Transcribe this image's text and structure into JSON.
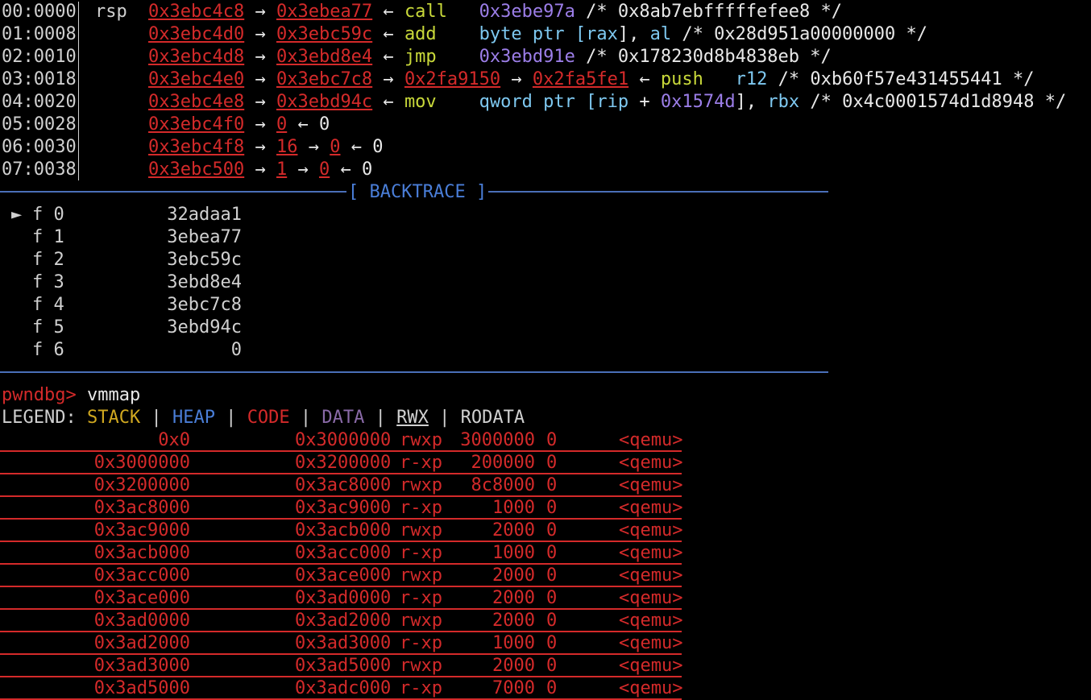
{
  "stack": [
    {
      "idx": "00:0000",
      "reg": "rsp",
      "chain": [
        {
          "t": "0x3ebc4c8",
          "c": "redu"
        },
        {
          "t": " → ",
          "c": "white"
        },
        {
          "t": "0x3ebea77",
          "c": "redu"
        },
        {
          "t": " ← ",
          "c": "white"
        },
        {
          "t": "call",
          "c": "yg"
        },
        {
          "t": "   ",
          "c": "white"
        },
        {
          "t": "0x3ebe97a",
          "c": "purple"
        },
        {
          "t": " /* 0x8ab7ebfffffefee8 */",
          "c": "white"
        }
      ]
    },
    {
      "idx": "01:0008",
      "reg": "",
      "chain": [
        {
          "t": "0x3ebc4d0",
          "c": "redu"
        },
        {
          "t": " → ",
          "c": "white"
        },
        {
          "t": "0x3ebc59c",
          "c": "redu"
        },
        {
          "t": " ← ",
          "c": "white"
        },
        {
          "t": "add",
          "c": "yg"
        },
        {
          "t": "    ",
          "c": "white"
        },
        {
          "t": "byte ptr [",
          "c": "cyan"
        },
        {
          "t": "rax",
          "c": "cyan"
        },
        {
          "t": "], ",
          "c": "white"
        },
        {
          "t": "al",
          "c": "cyan"
        },
        {
          "t": " /* 0x28d951a00000000 */",
          "c": "white"
        }
      ]
    },
    {
      "idx": "02:0010",
      "reg": "",
      "chain": [
        {
          "t": "0x3ebc4d8",
          "c": "redu"
        },
        {
          "t": " → ",
          "c": "white"
        },
        {
          "t": "0x3ebd8e4",
          "c": "redu"
        },
        {
          "t": " ← ",
          "c": "white"
        },
        {
          "t": "jmp",
          "c": "yg"
        },
        {
          "t": "    ",
          "c": "white"
        },
        {
          "t": "0x3ebd91e",
          "c": "purple"
        },
        {
          "t": " /* 0x178230d8b4838eb */",
          "c": "white"
        }
      ]
    },
    {
      "idx": "03:0018",
      "reg": "",
      "chain": [
        {
          "t": "0x3ebc4e0",
          "c": "redu"
        },
        {
          "t": " → ",
          "c": "white"
        },
        {
          "t": "0x3ebc7c8",
          "c": "redu"
        },
        {
          "t": " → ",
          "c": "white"
        },
        {
          "t": "0x2fa9150",
          "c": "redu"
        },
        {
          "t": " → ",
          "c": "white"
        },
        {
          "t": "0x2fa5fe1",
          "c": "redu"
        },
        {
          "t": " ← ",
          "c": "white"
        },
        {
          "t": "push",
          "c": "yg"
        },
        {
          "t": "   ",
          "c": "white"
        },
        {
          "t": "r12",
          "c": "cyan"
        },
        {
          "t": " /* 0xb60f57e431455441 */",
          "c": "white"
        }
      ]
    },
    {
      "idx": "04:0020",
      "reg": "",
      "chain": [
        {
          "t": "0x3ebc4e8",
          "c": "redu"
        },
        {
          "t": " → ",
          "c": "white"
        },
        {
          "t": "0x3ebd94c",
          "c": "redu"
        },
        {
          "t": " ← ",
          "c": "white"
        },
        {
          "t": "mov",
          "c": "yg"
        },
        {
          "t": "    ",
          "c": "white"
        },
        {
          "t": "qword ptr [",
          "c": "cyan"
        },
        {
          "t": "rip",
          "c": "cyan"
        },
        {
          "t": " + ",
          "c": "white"
        },
        {
          "t": "0x1574d",
          "c": "purple"
        },
        {
          "t": "], ",
          "c": "white"
        },
        {
          "t": "rbx",
          "c": "cyan"
        },
        {
          "t": " /* 0x4c0001574d1d8948 */",
          "c": "white"
        }
      ]
    },
    {
      "idx": "05:0028",
      "reg": "",
      "chain": [
        {
          "t": "0x3ebc4f0",
          "c": "redu"
        },
        {
          "t": " → ",
          "c": "white"
        },
        {
          "t": "0",
          "c": "redu"
        },
        {
          "t": " ← 0",
          "c": "white"
        }
      ]
    },
    {
      "idx": "06:0030",
      "reg": "",
      "chain": [
        {
          "t": "0x3ebc4f8",
          "c": "redu"
        },
        {
          "t": " → ",
          "c": "white"
        },
        {
          "t": "16",
          "c": "redu"
        },
        {
          "t": " → ",
          "c": "white"
        },
        {
          "t": "0",
          "c": "redu"
        },
        {
          "t": " ← 0",
          "c": "white"
        }
      ]
    },
    {
      "idx": "07:0038",
      "reg": "",
      "chain": [
        {
          "t": "0x3ebc500",
          "c": "redu"
        },
        {
          "t": " → ",
          "c": "white"
        },
        {
          "t": "1",
          "c": "redu"
        },
        {
          "t": " → ",
          "c": "white"
        },
        {
          "t": "0",
          "c": "redu"
        },
        {
          "t": " ← 0",
          "c": "white"
        }
      ]
    }
  ],
  "backtrace": {
    "title": "[ BACKTRACE ]",
    "current_marker": "►",
    "frames": [
      {
        "label": "f 0",
        "addr": "32adaa1"
      },
      {
        "label": "f 1",
        "addr": "3ebea77"
      },
      {
        "label": "f 2",
        "addr": "3ebc59c"
      },
      {
        "label": "f 3",
        "addr": "3ebd8e4"
      },
      {
        "label": "f 4",
        "addr": "3ebc7c8"
      },
      {
        "label": "f 5",
        "addr": "3ebd94c"
      },
      {
        "label": "f 6",
        "addr": "0"
      }
    ]
  },
  "prompt": {
    "text": "pwndbg>",
    "command": " vmmap"
  },
  "legend": {
    "label": "LEGEND:",
    "stack": "STACK",
    "heap": "HEAP",
    "code": "CODE",
    "data": "DATA",
    "rwx": "RWX",
    "rodata": "RODATA",
    "sep": " | "
  },
  "vmmap": [
    {
      "start": "0x0",
      "end": "0x3000000",
      "perm": "rwxp",
      "size": "3000000",
      "offset": "0",
      "name": "<qemu>"
    },
    {
      "start": "0x3000000",
      "end": "0x3200000",
      "perm": "r-xp",
      "size": "200000",
      "offset": "0",
      "name": "<qemu>"
    },
    {
      "start": "0x3200000",
      "end": "0x3ac8000",
      "perm": "rwxp",
      "size": "8c8000",
      "offset": "0",
      "name": "<qemu>"
    },
    {
      "start": "0x3ac8000",
      "end": "0x3ac9000",
      "perm": "r-xp",
      "size": "1000",
      "offset": "0",
      "name": "<qemu>"
    },
    {
      "start": "0x3ac9000",
      "end": "0x3acb000",
      "perm": "rwxp",
      "size": "2000",
      "offset": "0",
      "name": "<qemu>"
    },
    {
      "start": "0x3acb000",
      "end": "0x3acc000",
      "perm": "r-xp",
      "size": "1000",
      "offset": "0",
      "name": "<qemu>"
    },
    {
      "start": "0x3acc000",
      "end": "0x3ace000",
      "perm": "rwxp",
      "size": "2000",
      "offset": "0",
      "name": "<qemu>"
    },
    {
      "start": "0x3ace000",
      "end": "0x3ad0000",
      "perm": "r-xp",
      "size": "2000",
      "offset": "0",
      "name": "<qemu>"
    },
    {
      "start": "0x3ad0000",
      "end": "0x3ad2000",
      "perm": "rwxp",
      "size": "2000",
      "offset": "0",
      "name": "<qemu>"
    },
    {
      "start": "0x3ad2000",
      "end": "0x3ad3000",
      "perm": "r-xp",
      "size": "1000",
      "offset": "0",
      "name": "<qemu>"
    },
    {
      "start": "0x3ad3000",
      "end": "0x3ad5000",
      "perm": "rwxp",
      "size": "2000",
      "offset": "0",
      "name": "<qemu>"
    },
    {
      "start": "0x3ad5000",
      "end": "0x3adc000",
      "perm": "r-xp",
      "size": "7000",
      "offset": "0",
      "name": "<qemu>"
    }
  ]
}
